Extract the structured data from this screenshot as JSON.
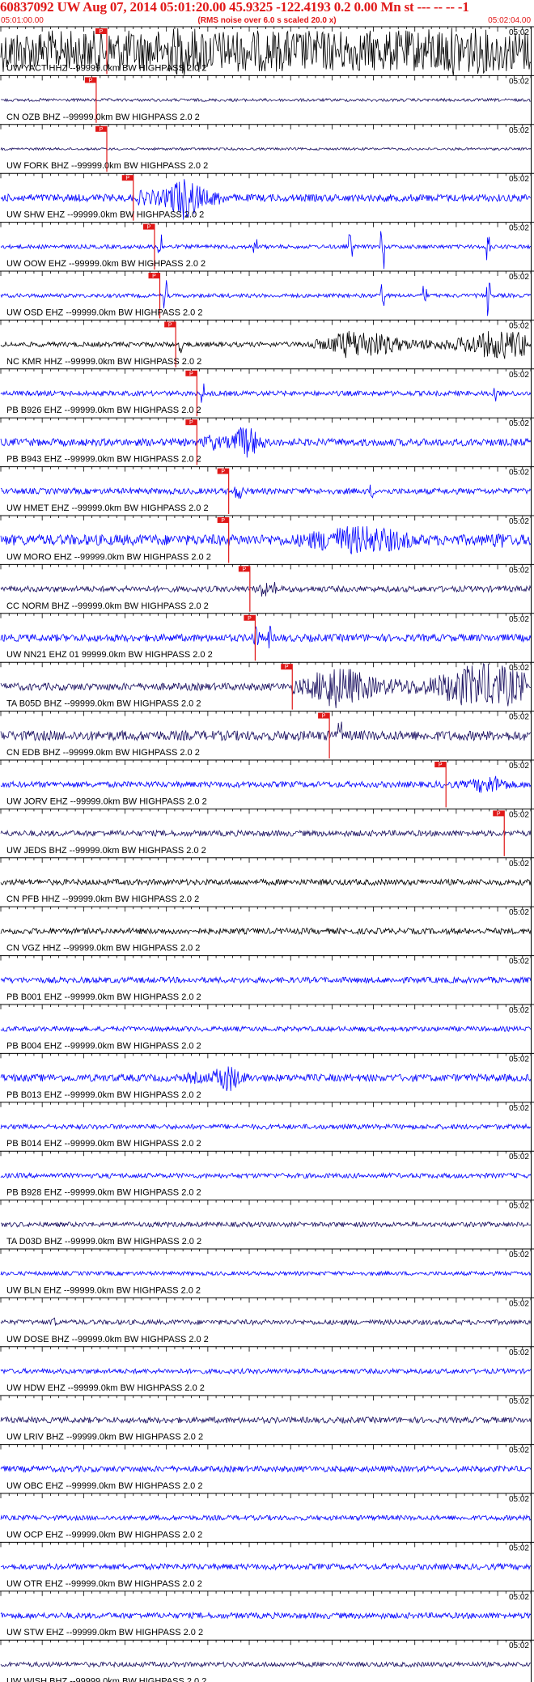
{
  "header": {
    "title": "60837092 UW Aug 07, 2014 05:01:20.00   45.9325 -122.4193  0.2 0.00 Mn st --- -- --   -1",
    "time_start": "05:01:00.00",
    "subtitle": "(RMS noise over 6.0 s scaled 20.0 x)",
    "time_end": "05:02:04.00"
  },
  "chart_data": {
    "type": "line",
    "title": "60837092 UW Aug 07, 2014 05:01:20.00   45.9325 -122.4193  0.2 0.00 Mn st --- -- --   -1",
    "subtitle": "(RMS noise over 6.0 s scaled 20.0 x)",
    "x_range": [
      "05:01:00.00",
      "05:02:04.00"
    ],
    "grid": false,
    "colors": {
      "black": "#000000",
      "blue": "#0000ff",
      "navy": "#1a1060",
      "pick": "#e01818"
    },
    "pick_label": "P",
    "traces": [
      {
        "label": "UW YACT HHZ --99999.0km BW  HIGHPASS  2.0  2",
        "time": "05:02",
        "color": "black",
        "amp": 0.85,
        "pick": 0.2,
        "burst": [
          0.2,
          0.95,
          1.0
        ],
        "spikes": []
      },
      {
        "label": "CN OZB BHZ --99999.0km BW  HIGHPASS  2.0  2",
        "time": "05:02",
        "color": "navy",
        "amp": 0.06,
        "pick": 0.18,
        "burst": null,
        "spikes": []
      },
      {
        "label": "UW FORK BHZ --99999.0km BW  HIGHPASS  2.0  2",
        "time": "05:02",
        "color": "navy",
        "amp": 0.05,
        "pick": 0.2,
        "burst": null,
        "spikes": []
      },
      {
        "label": "UW SHW EHZ --99999.0km BW  HIGHPASS  2.0  2",
        "time": "05:02",
        "color": "blue",
        "amp": 0.15,
        "pick": 0.25,
        "burst": [
          0.26,
          0.42,
          0.9
        ],
        "spikes": []
      },
      {
        "label": "UW OOW EHZ --99999.0km BW  HIGHPASS  2.0  2",
        "time": "05:02",
        "color": "blue",
        "amp": 0.08,
        "pick": 0.29,
        "burst": null,
        "spikes": [
          [
            0.3,
            0.7
          ],
          [
            0.48,
            0.45
          ],
          [
            0.66,
            0.5
          ],
          [
            0.72,
            0.95
          ],
          [
            0.92,
            0.8
          ]
        ]
      },
      {
        "label": "UW OSD EHZ --99999.0km BW  HIGHPASS  2.0  2",
        "time": "05:02",
        "color": "blue",
        "amp": 0.08,
        "pick": 0.3,
        "burst": null,
        "spikes": [
          [
            0.31,
            0.7
          ],
          [
            0.72,
            0.9
          ],
          [
            0.8,
            0.45
          ],
          [
            0.92,
            0.85
          ]
        ]
      },
      {
        "label": "NC KMR HHZ --99999.0km BW  HIGHPASS  2.0  2",
        "time": "05:02",
        "color": "black",
        "amp": 0.1,
        "pick": 0.33,
        "burst": [
          0.58,
          0.99,
          0.6
        ],
        "spikes": [
          [
            0.34,
            0.35
          ]
        ]
      },
      {
        "label": "PB B926 EHZ --99999.0km BW  HIGHPASS  2.0  2",
        "time": "05:02",
        "color": "blue",
        "amp": 0.1,
        "pick": 0.37,
        "burst": null,
        "spikes": [
          [
            0.38,
            0.45
          ],
          [
            0.93,
            0.35
          ]
        ]
      },
      {
        "label": "PB B943 EHZ --99999.0km BW  HIGHPASS  2.0  2",
        "time": "05:02",
        "color": "blue",
        "amp": 0.15,
        "pick": 0.37,
        "burst": [
          0.38,
          0.5,
          0.7
        ],
        "spikes": []
      },
      {
        "label": "UW HMET EHZ --99999.0km BW  HIGHPASS  2.0  2",
        "time": "05:02",
        "color": "blue",
        "amp": 0.12,
        "pick": 0.43,
        "burst": [
          0.42,
          0.47,
          0.35
        ],
        "spikes": [
          [
            0.7,
            0.3
          ]
        ]
      },
      {
        "label": "UW MORO EHZ --99999.0km BW  HIGHPASS  2.0  2",
        "time": "05:02",
        "color": "blue",
        "amp": 0.22,
        "pick": 0.43,
        "burst": [
          0.44,
          0.95,
          0.6
        ],
        "spikes": []
      },
      {
        "label": "CC NORM BHZ --99999.0km BW  HIGHPASS  2.0  2",
        "time": "05:02",
        "color": "navy",
        "amp": 0.12,
        "pick": 0.47,
        "burst": [
          0.48,
          0.52,
          0.45
        ],
        "spikes": []
      },
      {
        "label": "UW NN21 EHZ 01 99999.0km BW  HIGHPASS  2.0  2",
        "time": "05:02",
        "color": "blue",
        "amp": 0.15,
        "pick": 0.48,
        "burst": [
          0.47,
          0.51,
          0.5
        ],
        "spikes": []
      },
      {
        "label": "TA B05D BHZ --99999.0km BW  HIGHPASS  2.0  2",
        "time": "05:02",
        "color": "navy",
        "amp": 0.15,
        "pick": 0.55,
        "burst": [
          0.55,
          0.99,
          0.95
        ],
        "spikes": []
      },
      {
        "label": "CN EDB BHZ --99999.0km BW  HIGHPASS  2.0  2",
        "time": "05:02",
        "color": "navy",
        "amp": 0.2,
        "pick": 0.62,
        "burst": null,
        "spikes": [
          [
            0.64,
            0.6
          ]
        ]
      },
      {
        "label": "UW JORV EHZ --99999.0km BW  HIGHPASS  2.0  2",
        "time": "05:02",
        "color": "blue",
        "amp": 0.12,
        "pick": 0.84,
        "burst": [
          0.82,
          0.99,
          0.4
        ],
        "spikes": []
      },
      {
        "label": "UW JEDS BHZ --99999.0km BW  HIGHPASS  2.0  2",
        "time": "05:02",
        "color": "navy",
        "amp": 0.12,
        "pick": 0.95,
        "burst": null,
        "spikes": []
      },
      {
        "label": "CN PFB HHZ --99999.0km BW  HIGHPASS  2.0  2",
        "time": "05:02",
        "color": "black",
        "amp": 0.12,
        "pick": null,
        "burst": null,
        "spikes": []
      },
      {
        "label": "CN VGZ HHZ --99999.0km BW  HIGHPASS  2.0  2",
        "time": "05:02",
        "color": "black",
        "amp": 0.12,
        "pick": null,
        "burst": null,
        "spikes": []
      },
      {
        "label": "PB B001 EHZ --99999.0km BW  HIGHPASS  2.0  2",
        "time": "05:02",
        "color": "blue",
        "amp": 0.12,
        "pick": null,
        "burst": null,
        "spikes": []
      },
      {
        "label": "PB B004 EHZ --99999.0km BW  HIGHPASS  2.0  2",
        "time": "05:02",
        "color": "blue",
        "amp": 0.1,
        "pick": null,
        "burst": null,
        "spikes": []
      },
      {
        "label": "PB B013 EHZ --99999.0km BW  HIGHPASS  2.0  2",
        "time": "05:02",
        "color": "blue",
        "amp": 0.15,
        "pick": null,
        "burst": [
          0.35,
          0.47,
          0.6
        ],
        "spikes": []
      },
      {
        "label": "PB B014 EHZ --99999.0km BW  HIGHPASS  2.0  2",
        "time": "05:02",
        "color": "blue",
        "amp": 0.1,
        "pick": null,
        "burst": null,
        "spikes": []
      },
      {
        "label": "PB B928 EHZ --99999.0km BW  HIGHPASS  2.0  2",
        "time": "05:02",
        "color": "blue",
        "amp": 0.1,
        "pick": null,
        "burst": null,
        "spikes": []
      },
      {
        "label": "TA D03D BHZ --99999.0km BW  HIGHPASS  2.0  2",
        "time": "05:02",
        "color": "navy",
        "amp": 0.1,
        "pick": null,
        "burst": null,
        "spikes": []
      },
      {
        "label": "UW BLN EHZ --99999.0km BW  HIGHPASS  2.0  2",
        "time": "05:02",
        "color": "blue",
        "amp": 0.08,
        "pick": null,
        "burst": null,
        "spikes": []
      },
      {
        "label": "UW DOSE BHZ --99999.0km BW  HIGHPASS  2.0  2",
        "time": "05:02",
        "color": "navy",
        "amp": 0.1,
        "pick": null,
        "burst": null,
        "spikes": [
          [
            0.1,
            0.3
          ]
        ]
      },
      {
        "label": "UW HDW EHZ --99999.0km BW  HIGHPASS  2.0  2",
        "time": "05:02",
        "color": "blue",
        "amp": 0.1,
        "pick": null,
        "burst": null,
        "spikes": []
      },
      {
        "label": "UW LRIV BHZ --99999.0km BW  HIGHPASS  2.0  2",
        "time": "05:02",
        "color": "navy",
        "amp": 0.12,
        "pick": null,
        "burst": null,
        "spikes": []
      },
      {
        "label": "UW OBC EHZ --99999.0km BW  HIGHPASS  2.0  2",
        "time": "05:02",
        "color": "blue",
        "amp": 0.12,
        "pick": null,
        "burst": null,
        "spikes": []
      },
      {
        "label": "UW OCP EHZ --99999.0km BW  HIGHPASS  2.0  2",
        "time": "05:02",
        "color": "blue",
        "amp": 0.1,
        "pick": null,
        "burst": null,
        "spikes": []
      },
      {
        "label": "UW OTR EHZ --99999.0km BW  HIGHPASS  2.0  2",
        "time": "05:02",
        "color": "blue",
        "amp": 0.12,
        "pick": null,
        "burst": null,
        "spikes": []
      },
      {
        "label": "UW STW EHZ --99999.0km BW  HIGHPASS  2.0  2",
        "time": "05:02",
        "color": "blue",
        "amp": 0.12,
        "pick": null,
        "burst": null,
        "spikes": []
      },
      {
        "label": "UW WISH BHZ --99999.0km BW  HIGHPASS  2.0  2",
        "time": "05:02",
        "color": "navy",
        "amp": 0.1,
        "pick": null,
        "burst": null,
        "spikes": []
      }
    ]
  }
}
